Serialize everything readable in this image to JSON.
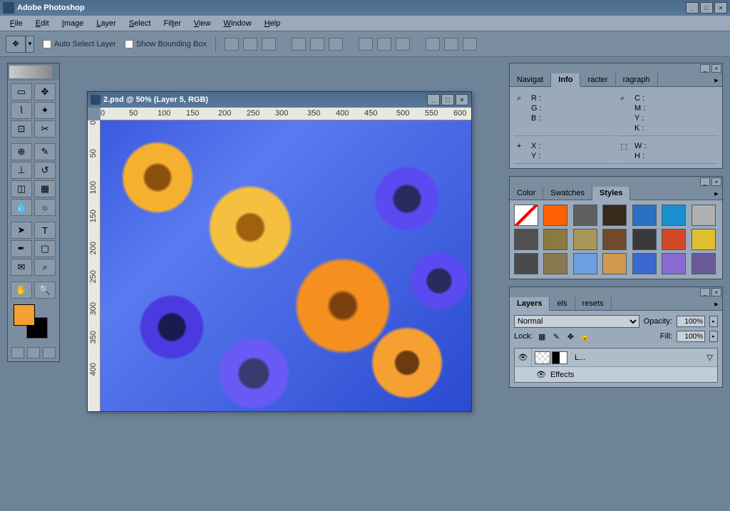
{
  "app": {
    "title": "Adobe Photoshop"
  },
  "menus": [
    "File",
    "Edit",
    "Image",
    "Layer",
    "Select",
    "Filter",
    "View",
    "Window",
    "Help"
  ],
  "options": {
    "autoselect_label": "Auto Select Layer",
    "showbb_label": "Show Bounding Box"
  },
  "document": {
    "title": "2.psd @ 50% (Layer 5, RGB)",
    "ruler_h": [
      "0",
      "50",
      "100",
      "150",
      "200",
      "250",
      "300",
      "350",
      "400",
      "450",
      "500",
      "550",
      "600"
    ],
    "ruler_v": [
      "0",
      "50",
      "100",
      "150",
      "200",
      "250",
      "300",
      "350",
      "400"
    ]
  },
  "info_panel": {
    "tabs": [
      "Navigat",
      "Info",
      "racter",
      "ragraph"
    ],
    "active": 1,
    "left1": [
      "R :",
      "G :",
      "B :"
    ],
    "right1": [
      "C :",
      "M :",
      "Y :",
      "K :"
    ],
    "left2": [
      "X :",
      "Y :"
    ],
    "right2": [
      "W :",
      "H :"
    ]
  },
  "styles_panel": {
    "tabs": [
      "Color",
      "Swatches",
      "Styles"
    ],
    "active": 2,
    "swatches": [
      "#ffffff",
      "#ff6000",
      "#606060",
      "#3a2a1a",
      "#2a70c0",
      "#1a90d0",
      "#b0b0b0",
      "#505050",
      "#8a7a40",
      "#a89858",
      "#704a2a",
      "#3a3a3a",
      "#d04a2a",
      "#e0c030",
      "#4a4a4a",
      "#887a50",
      "#6aa0e0",
      "#d09a50",
      "#3a6ad0",
      "#8a6ad0",
      "#6a5a9a"
    ]
  },
  "layers_panel": {
    "tabs": [
      "Layers",
      "els",
      "resets"
    ],
    "active": 0,
    "blend_mode": "Normal",
    "opacity_label": "Opacity:",
    "opacity": "100%",
    "lock_label": "Lock:",
    "fill_label": "Fill:",
    "fill": "100%",
    "layer_name": "L...",
    "effects_label": "Effects"
  },
  "tools": [
    "marquee",
    "move",
    "lasso",
    "wand",
    "crop",
    "slice",
    "heal",
    "brush",
    "stamp",
    "history",
    "eraser",
    "gradient",
    "blur",
    "dodge",
    "path",
    "type",
    "pen",
    "shape",
    "notes",
    "eyedrop",
    "hand",
    "zoom"
  ]
}
